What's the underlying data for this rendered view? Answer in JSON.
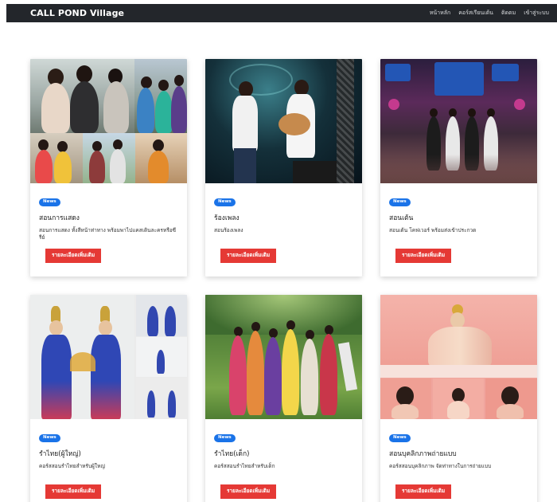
{
  "navbar": {
    "brand": "CALL POND Village",
    "links": [
      "หน้าหลัก",
      "คอร์สเรียนเต้น",
      "ติดตม",
      "เข้าสู่ระบบ"
    ]
  },
  "cards": [
    {
      "badge": "News",
      "title": "สอนการแสดง",
      "desc": "สอนการแสดง ทั้งสีหน้าท่าทาง พร้อมพาไปแคสเดินละครหรือซีรีย์",
      "button": "รายละเอียดเพิ่มเติม",
      "image": "group-photo-collage"
    },
    {
      "badge": "News",
      "title": "ร้องเพลง",
      "desc": "สอนร้องเพลง",
      "button": "รายละเอียดเพิ่มเติม",
      "image": "singers-on-stage-photo"
    },
    {
      "badge": "News",
      "title": "สอนเต้น",
      "desc": "สอนเต้น โคฟเวอร์ พร้อมส่งเข้าประกวด",
      "button": "รายละเอียดเพิ่มเติม",
      "image": "dance-showcase-stage-photo"
    },
    {
      "badge": "News",
      "title": "รำไทย(ผู้ใหญ่)",
      "desc": "คอร์สสอนรำไทยสำหรับผู้ใหญ่",
      "button": "รายละเอียดเพิ่มเติม",
      "image": "thai-dance-adults-collage"
    },
    {
      "badge": "News",
      "title": "รำไทย(เด็ก)",
      "desc": "คอร์สสอนรำไทยสำหรับเด็ก",
      "button": "รายละเอียดเพิ่มเติม",
      "image": "thai-dance-kids-photo"
    },
    {
      "badge": "News",
      "title": "สอนบุคลิกภาพถ่ายแบบ",
      "desc": "คอร์สสอนบุคลิกภาพ จัดท่าทางในการถ่ายแบบ",
      "button": "รายละเอียดเพิ่มเติม",
      "image": "model-posing-collage"
    }
  ],
  "colors": {
    "navbar": "#23262b",
    "badge": "#1a73e8",
    "button": "#e53935"
  }
}
